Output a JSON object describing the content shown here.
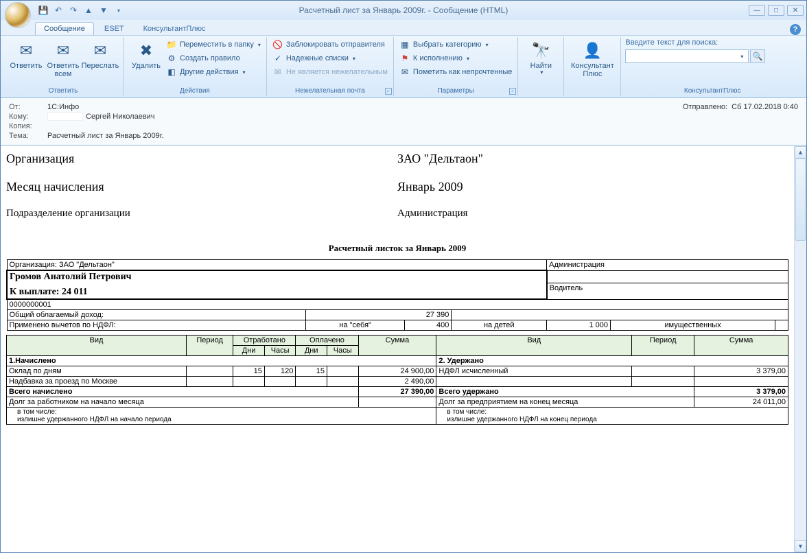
{
  "window": {
    "title": "Расчетный лист за Январь 2009г. - Сообщение (HTML)"
  },
  "tabs": {
    "message": "Сообщение",
    "eset": "ESET",
    "consultant": "КонсультантПлюс"
  },
  "ribbon": {
    "reply": {
      "reply": "Ответить",
      "reply_all": "Ответить\nвсем",
      "forward": "Переслать",
      "group": "Ответить"
    },
    "actions": {
      "delete": "Удалить",
      "move_to_folder": "Переместить в папку",
      "create_rule": "Создать правило",
      "other_actions": "Другие действия",
      "group": "Действия"
    },
    "junk": {
      "block_sender": "Заблокировать отправителя",
      "safe_lists": "Надежные списки",
      "not_junk": "Не является нежелательным",
      "group": "Нежелательная почта"
    },
    "options": {
      "categorize": "Выбрать категорию",
      "follow_up": "К исполнению",
      "mark_unread": "Пометить как непрочтенные",
      "group": "Параметры"
    },
    "find": {
      "find": "Найти",
      "group": ""
    },
    "consultant_btn": {
      "label": "Консультант\nПлюс"
    },
    "search": {
      "label": "Введите текст для поиска:",
      "placeholder": "",
      "group": "КонсультантПлюс"
    }
  },
  "headers": {
    "from_label": "От:",
    "from_value": "1С:Инфо",
    "to_label": "Кому:",
    "to_value": "Сергей Николаевич",
    "cc_label": "Копия:",
    "cc_value": "",
    "subject_label": "Тема:",
    "subject_value": "Расчетный лист за Январь 2009г.",
    "sent_label": "Отправлено:",
    "sent_value": "Сб 17.02.2018 0:40"
  },
  "doc": {
    "org_label": "Организация",
    "org_value": "ЗАО \"Дельтаон\"",
    "month_label": "Месяц начисления",
    "month_value": "Январь 2009",
    "dept_label": "Подразделение организации",
    "dept_value": "Администрация",
    "title": "Расчетный листок за Январь 2009",
    "org_line": "Организация: ЗАО \"Дельтаон\"",
    "dept_line": "Администрация",
    "employee": "Громов Анатолий Петрович",
    "payout_label": "К выплате: 24 011",
    "position": "Водитель",
    "tab_num": "0000000001",
    "taxable_income_label": "Общий облагаемый доход:",
    "taxable_income": "27 390",
    "deductions_label": "Применено вычетов по НДФЛ:",
    "ded_self_label": "на \"себя\"",
    "ded_self": "400",
    "ded_children_label": "на детей",
    "ded_children": "1 000",
    "ded_property_label": "имущественных",
    "ded_property": "",
    "cols": {
      "vid": "Вид",
      "period": "Период",
      "worked": "Отработано",
      "paid": "Оплачено",
      "days": "Дни",
      "hours": "Часы",
      "sum": "Сумма"
    },
    "sec_charged": "1.Начислено",
    "sec_withheld": "2. Удержано",
    "row1": {
      "name": "Оклад по дням",
      "wd": "15",
      "wh": "120",
      "pd": "15",
      "ph": "",
      "sum": "24 900,00"
    },
    "row2": {
      "name": "Надбавка за проезд по Москве",
      "sum": "2 490,00"
    },
    "withheld1": {
      "name": "НДФЛ исчисленный",
      "sum": "3 379,00"
    },
    "total_charged_label": "Всего начислено",
    "total_charged": "27 390,00",
    "total_withheld_label": "Всего удержано",
    "total_withheld": "3 379,00",
    "debt_worker_label": "Долг за работником на начало месяца",
    "debt_worker": "",
    "debt_company_label": "Долг за предприятием на конец месяца",
    "debt_company": "24 011,00",
    "incl_label": "в том числе:",
    "excess_start": "излишне удержанного НДФЛ на начало периода",
    "excess_end": "излишне удержанного НДФЛ на конец периода"
  }
}
